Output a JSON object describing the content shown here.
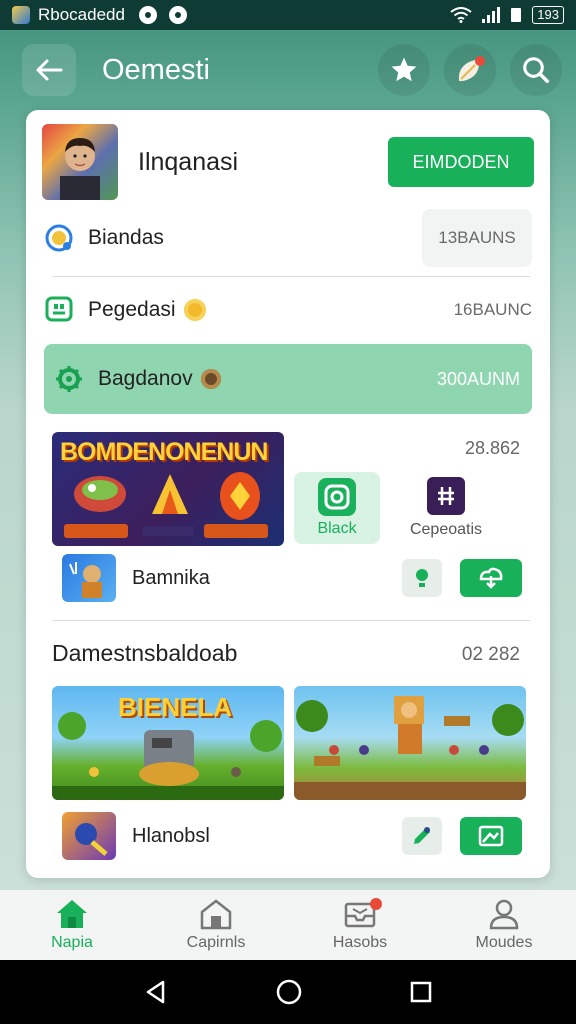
{
  "status_bar": {
    "app_name": "Rbocadedd",
    "battery": "193"
  },
  "header": {
    "title": "Oemesti"
  },
  "profile": {
    "name": "Ilnqanasi",
    "action_label": "EIMDODEN"
  },
  "rows": [
    {
      "label": "Biandas",
      "value": "13BAUNS"
    },
    {
      "label": "Pegedasi",
      "value": "16BAUNC"
    },
    {
      "label": "Bagdanov",
      "value": "300AUNM"
    }
  ],
  "featured": {
    "banner_title": "BOMDENONENUN",
    "date": "28.862",
    "tiles": [
      {
        "label": "Black",
        "icon": "camera-icon"
      },
      {
        "label": "Cepeoatis",
        "icon": "app-icon"
      }
    ],
    "game": {
      "name": "Bamnika"
    }
  },
  "section2": {
    "title": "Damestnsbaldoab",
    "date": "02 282",
    "screenshot_title": "BIENELA",
    "game": {
      "name": "Hlanobsl"
    }
  },
  "bottom_nav": [
    {
      "label": "Napia",
      "icon": "home-icon",
      "active": true
    },
    {
      "label": "Capirnls",
      "icon": "building-icon"
    },
    {
      "label": "Hasobs",
      "icon": "inbox-icon"
    },
    {
      "label": "Moudes",
      "icon": "person-icon"
    }
  ],
  "colors": {
    "accent": "#18b15a",
    "highlight_row": "#8fd6b0",
    "header_bg": "#3f8f78"
  }
}
